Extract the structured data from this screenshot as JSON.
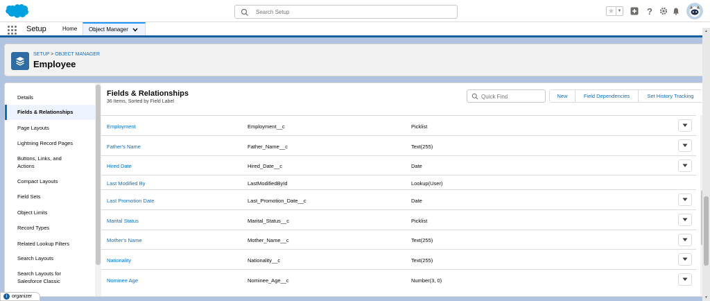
{
  "header": {
    "search_placeholder": "Search Setup"
  },
  "nav": {
    "app_name": "Setup",
    "tabs": [
      {
        "label": "Home"
      },
      {
        "label": "Object Manager"
      }
    ]
  },
  "object": {
    "breadcrumb_setup": "SETUP",
    "breadcrumb_sep": ">",
    "breadcrumb_object_manager": "OBJECT MANAGER",
    "title": "Employee"
  },
  "sidebar": {
    "items": [
      {
        "label": "Details"
      },
      {
        "label": "Fields & Relationships"
      },
      {
        "label": "Page Layouts"
      },
      {
        "label": "Lightning Record Pages"
      },
      {
        "label": "Buttons, Links, and Actions"
      },
      {
        "label": "Compact Layouts"
      },
      {
        "label": "Field Sets"
      },
      {
        "label": "Object Limits"
      },
      {
        "label": "Record Types"
      },
      {
        "label": "Related Lookup Filters"
      },
      {
        "label": "Search Layouts"
      },
      {
        "label": "Search Layouts for Salesforce Classic"
      }
    ]
  },
  "section": {
    "title": "Fields & Relationships",
    "subtitle": "36 Items, Sorted by Field Label",
    "quick_find_placeholder": "Quick Find",
    "buttons": {
      "new": "New",
      "field_dependencies": "Field Dependencies",
      "history_tracking": "Set History Tracking"
    }
  },
  "fields": [
    {
      "label": "Employment",
      "api": "Employment__c",
      "type": "Picklist",
      "has_action": true
    },
    {
      "label": "Father's Name",
      "api": "Father_Name__c",
      "type": "Text(255)",
      "has_action": true
    },
    {
      "label": "Hired Date",
      "api": "Hired_Date__c",
      "type": "Date",
      "has_action": true
    },
    {
      "label": "Last Modified By",
      "api": "LastModifiedById",
      "type": "Lookup(User)",
      "has_action": false
    },
    {
      "label": "Last Promotion Date",
      "api": "Last_Promotion_Date__c",
      "type": "Date",
      "has_action": true
    },
    {
      "label": "Marital Status",
      "api": "Marital_Status__c",
      "type": "Picklist",
      "has_action": true
    },
    {
      "label": "Mother's Name",
      "api": "Mother_Name__c",
      "type": "Text(255)",
      "has_action": true
    },
    {
      "label": "Nationality",
      "api": "Nationality__c",
      "type": "Text(255)",
      "has_action": true
    },
    {
      "label": "Nominee Age",
      "api": "Nominee_Age__c",
      "type": "Number(3, 0)",
      "has_action": true
    }
  ],
  "organizer": {
    "label": "organizer"
  },
  "colors": {
    "brand": "#00a1e0",
    "link": "#0070d2",
    "object_icon": "#2e6ca3",
    "nav_border": "#1b5f9e"
  }
}
